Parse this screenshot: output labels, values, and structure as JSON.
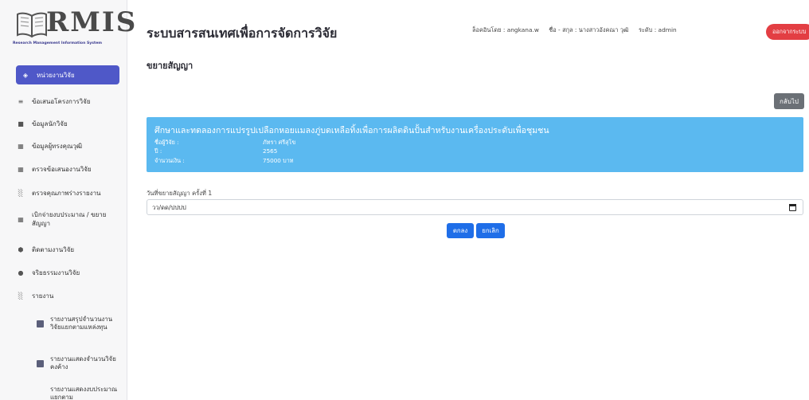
{
  "logo": {
    "text": "RMIS",
    "subtitle": "Research Management Information System"
  },
  "header": {
    "title": "ระบบสารสนเทศเพื่อการจัดการวิจัย",
    "login": "ล็อคอินโดย : angkana.w",
    "name": "ชื่อ - สกุล : นางสาวอังคณา วุฒิ",
    "level": "ระดับ : admin",
    "logout_label": "ออกจากระบบ"
  },
  "sidebar": {
    "items": [
      {
        "label": "หน่วยงานวิจัย",
        "icon": "layers-icon"
      },
      {
        "label": "ข้อเสนอโครงการวิจัย",
        "icon": "layers-icon"
      },
      {
        "label": "ข้อมูลนักวิจัย",
        "icon": "briefcase-icon"
      },
      {
        "label": "ข้อมูลผู้ทรงคุณวุฒิ",
        "icon": "grid-icon"
      },
      {
        "label": "ตรวจข้อเสนองานวิจัย",
        "icon": "grid-icon"
      },
      {
        "label": "ตรวจคุณภาพร่างรายงาน",
        "icon": "bar-chart-icon"
      },
      {
        "label": "เบิกจ่ายงบประมาณ / ขยายสัญญา",
        "icon": "grid-icon"
      },
      {
        "label": "ติดตามงานวิจัย",
        "icon": "cube-icon"
      },
      {
        "label": "จริยธรรมงานวิจัย",
        "icon": "drop-icon"
      },
      {
        "label": "รายงาน",
        "icon": "bar-chart-icon"
      }
    ],
    "sub_items": [
      {
        "label": "รายงานสรุปจำนวนงานวิจัยแยกตามแหล่งทุน"
      },
      {
        "label": "รายงานแสดงจำนวนวิจัยคงค้าง"
      },
      {
        "label": "รายงานแสดงงบประมาณแยกตาม"
      }
    ]
  },
  "main": {
    "subheading": "ขยายสัญญา",
    "back_label": "กลับไป",
    "card": {
      "title": "ศึกษาและทดลองการแปรรูปเปลือกหอยแมลงภู่บดเหลือทิ้งเพื่อการผลิตดินปั้นสำหรับงานเครื่องประดับเพื่อชุมชน",
      "researcher_label": "ชื่อผู้วิจัย :",
      "researcher_value": "ภัทรา ศรีสุโข",
      "year_label": "ปี :",
      "year_value": "2565",
      "amount_label": "จำนวนเงิน :",
      "amount_value": "75000 บาท"
    },
    "date_label": "วันที่ขยายสัญญา ครั้งที่ 1",
    "date_placeholder": "วว/ดด/ปปปป",
    "ok_label": "ตกลง",
    "cancel_label": "ยกเลิก"
  },
  "colors": {
    "accent": "#4f58c8",
    "card": "#5bb9f0",
    "primary_button": "#1f6ee8",
    "logout": "#e33e43"
  }
}
